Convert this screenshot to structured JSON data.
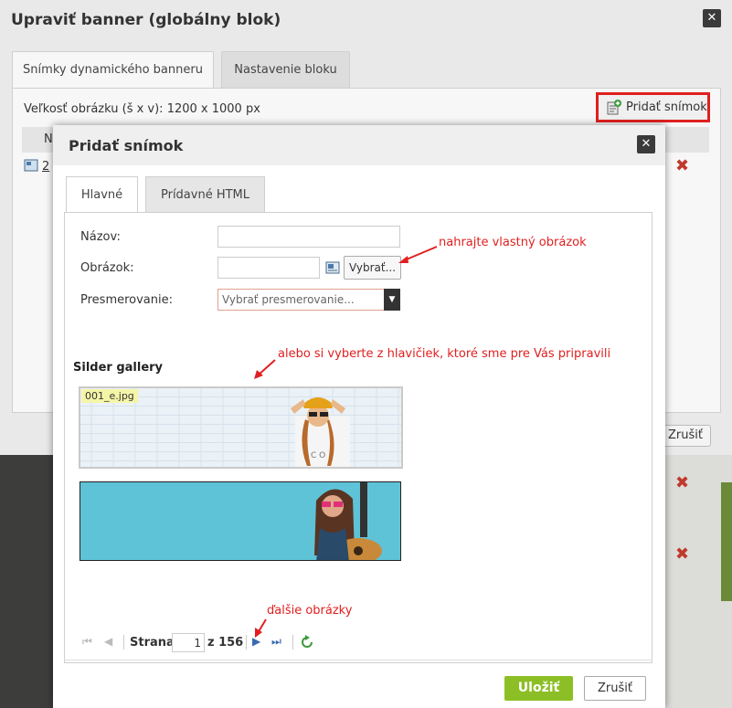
{
  "outer": {
    "title": "Upraviť banner (globálny blok)",
    "tabs": [
      {
        "label": "Snímky dynamického banneru",
        "active": true
      },
      {
        "label": "Nastavenie bloku",
        "active": false
      }
    ],
    "size_label": "Veľkosť obrázku (š x v): 1200 x 1000 px",
    "add_slide_label": "Pridať snímok",
    "list_header_fragment": "N",
    "list_row_fragment": "2",
    "cancel_fragment": "Zrušiť"
  },
  "inner": {
    "title": "Pridať snímok",
    "tabs": [
      {
        "label": "Hlavné",
        "active": true
      },
      {
        "label": "Prídavné HTML",
        "active": false
      }
    ],
    "form": {
      "name_label": "Názov:",
      "name_value": "",
      "image_label": "Obrázok:",
      "image_value": "",
      "choose_button": "Vybrať...",
      "redirect_label": "Presmerovanie:",
      "redirect_placeholder": "Vybrať presmerovanie..."
    },
    "gallery": {
      "title": "Silder gallery",
      "items": [
        {
          "filename": "001_e.jpg"
        },
        {
          "filename": ""
        }
      ]
    },
    "pager": {
      "page_label": "Strana",
      "page_value": "1",
      "of_label": "z 156"
    },
    "save_button": "Uložiť",
    "cancel_button": "Zrušiť"
  },
  "annotations": {
    "upload": "nahrajte vlastný obrázok",
    "choose": "alebo si vyberte z hlavičiek, ktoré sme pre Vás pripravili",
    "more": "ďalšie obrázky"
  },
  "colors": {
    "accent_green": "#8cbf26",
    "annotation_red": "#e02020",
    "delete_red": "#c0392b"
  }
}
